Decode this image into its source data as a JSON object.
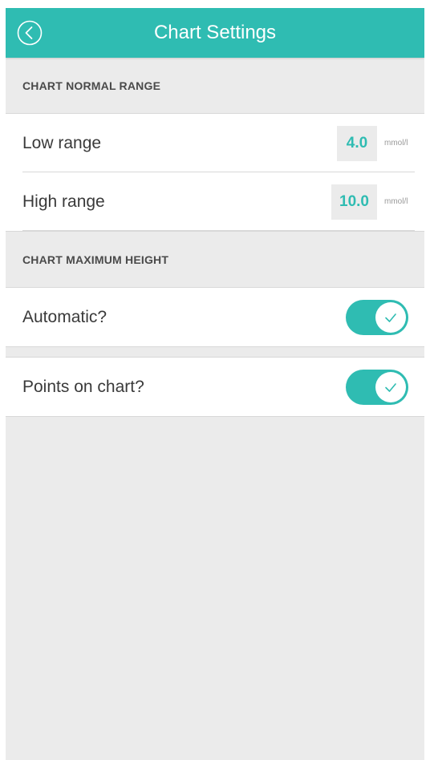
{
  "header": {
    "title": "Chart Settings",
    "back_icon": "back-chevron-circle-icon"
  },
  "sections": {
    "normal_range": {
      "title": "CHART NORMAL RANGE",
      "low": {
        "label": "Low range",
        "value": "4.0",
        "unit": "mmol/l"
      },
      "high": {
        "label": "High range",
        "value": "10.0",
        "unit": "mmol/l"
      }
    },
    "max_height": {
      "title": "CHART MAXIMUM HEIGHT",
      "automatic": {
        "label": "Automatic?",
        "on": true
      }
    },
    "points": {
      "label": "Points on chart?",
      "on": true
    }
  },
  "colors": {
    "accent": "#2fbcb2",
    "background": "#ebebeb",
    "card": "#ffffff"
  }
}
